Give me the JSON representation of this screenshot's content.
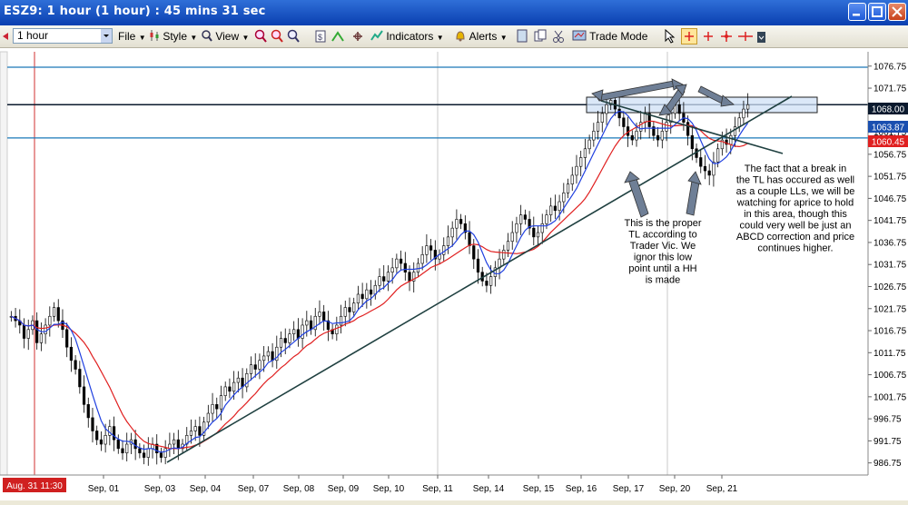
{
  "window": {
    "title": "ESZ9: 1 hour (1 hour) : 45 mins 31 sec"
  },
  "toolbar": {
    "interval": "1 hour",
    "file_label": "File",
    "style_label": "Style",
    "view_label": "View",
    "indicators_label": "Indicators",
    "alerts_label": "Alerts",
    "trade_mode_label": "Trade Mode"
  },
  "chart_data": {
    "type": "candlestick",
    "y_ticks": [
      "1076.75",
      "1071.75",
      "1066.75",
      "1061.75",
      "1056.75",
      "1051.75",
      "1046.75",
      "1041.75",
      "1036.75",
      "1031.75",
      "1026.75",
      "1021.75",
      "1016.75",
      "1011.75",
      "1006.75",
      "1001.75",
      "996.75",
      "991.75",
      "986.75"
    ],
    "ylim": [
      984,
      1080
    ],
    "x_ticks": [
      "Aug. 31 11:30",
      "Sep, 01",
      "Sep, 03",
      "Sep, 04",
      "Sep, 07",
      "Sep, 08",
      "Sep, 09",
      "Sep, 10",
      "Sep, 11",
      "Sep, 14",
      "Sep, 15",
      "Sep, 16",
      "Sep, 17",
      "Sep, 20",
      "Sep, 21"
    ],
    "price_labels": {
      "last": "1068.00",
      "ma_fast": "1063.87",
      "ma_slow": "1060.45"
    },
    "horizontal_levels": [
      1076.5,
      1068.0,
      1060.45
    ],
    "closes": [
      1020,
      1019,
      1018,
      1015,
      1017,
      1019,
      1014,
      1016,
      1018,
      1020,
      1022,
      1019,
      1017,
      1013,
      1010,
      1008,
      1004,
      1000,
      997,
      994,
      992,
      991,
      993,
      995,
      992,
      990,
      989,
      991,
      992,
      990,
      989,
      988,
      990,
      991,
      989,
      988,
      990,
      991,
      992,
      990,
      991,
      993,
      994,
      995,
      993,
      996,
      998,
      1000,
      999,
      1002,
      1004,
      1003,
      1005,
      1006,
      1004,
      1007,
      1009,
      1008,
      1010,
      1011,
      1012,
      1010,
      1013,
      1015,
      1014,
      1016,
      1017,
      1015,
      1018,
      1019,
      1017,
      1020,
      1021,
      1019,
      1017,
      1016,
      1018,
      1020,
      1022,
      1021,
      1023,
      1025,
      1024,
      1026,
      1025,
      1027,
      1029,
      1028,
      1030,
      1031,
      1033,
      1032,
      1030,
      1028,
      1030,
      1032,
      1034,
      1036,
      1035,
      1033,
      1034,
      1036,
      1038,
      1040,
      1042,
      1041,
      1039,
      1036,
      1033,
      1030,
      1028,
      1027,
      1029,
      1031,
      1033,
      1035,
      1037,
      1039,
      1041,
      1043,
      1042,
      1040,
      1038,
      1039,
      1041,
      1043,
      1045,
      1044,
      1046,
      1048,
      1050,
      1052,
      1054,
      1056,
      1058,
      1060,
      1062,
      1064,
      1066,
      1068,
      1069,
      1067,
      1065,
      1063,
      1061,
      1060,
      1062,
      1064,
      1066,
      1063,
      1061,
      1060,
      1062,
      1064,
      1066,
      1068,
      1066,
      1064,
      1061,
      1058,
      1056,
      1054,
      1053,
      1052,
      1055,
      1058,
      1060,
      1059,
      1061,
      1063,
      1065,
      1067,
      1068
    ]
  },
  "annotations": {
    "tl_note": "This is the proper TL according to Trader Vic. We ignor this low point until a HH is made",
    "break_note": "The fact that a break in the TL has occured as well as a couple LLs, we will be watching for aprice to hold in this area, though this could very well be just an ABCD correction and price continues higher."
  }
}
